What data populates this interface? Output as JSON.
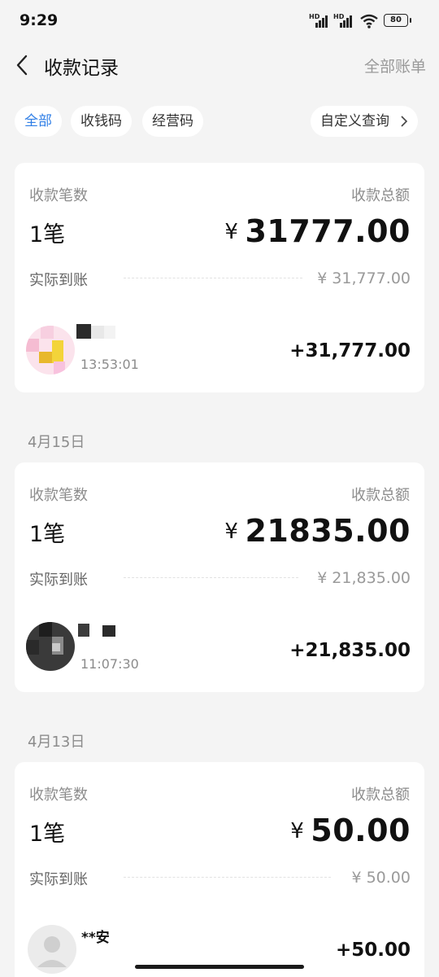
{
  "status_bar": {
    "time": "9:29",
    "battery": "80",
    "hd_label": "HD"
  },
  "header": {
    "title": "收款记录",
    "right_link": "全部账单"
  },
  "filters": {
    "all": "全部",
    "payment_code": "收钱码",
    "business_code": "经营码",
    "custom_query": "自定义查询"
  },
  "labels": {
    "count_label": "收款笔数",
    "total_label": "收款总额",
    "actual_label": "实际到账",
    "currency": "¥"
  },
  "groups": [
    {
      "date": "",
      "count": "1笔",
      "total": "31777.00",
      "actual": "31,777.00",
      "transaction": {
        "name": "",
        "time": "13:53:01",
        "amount": "+31,777.00"
      }
    },
    {
      "date": "4月15日",
      "count": "1笔",
      "total": "21835.00",
      "actual": "21,835.00",
      "transaction": {
        "name": "",
        "time": "11:07:30",
        "amount": "+21,835.00"
      }
    },
    {
      "date": "4月13日",
      "count": "1笔",
      "total": "50.00",
      "actual": "50.00",
      "transaction": {
        "name": "**安",
        "time": "",
        "amount": "+50.00"
      }
    }
  ],
  "colors": {
    "accent": "#2f7ee6",
    "background": "#f4f4f4",
    "muted": "#8c8c8c"
  }
}
